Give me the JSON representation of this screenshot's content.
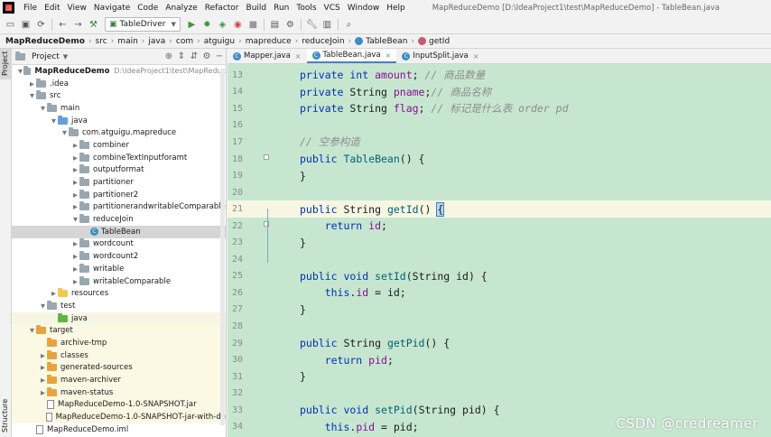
{
  "menubar": {
    "items": [
      "File",
      "Edit",
      "View",
      "Navigate",
      "Code",
      "Analyze",
      "Refactor",
      "Build",
      "Run",
      "Tools",
      "VCS",
      "Window",
      "Help"
    ],
    "title": "MapReduceDemo [D:\\IdeaProject1\\test\\MapReduceDemo] - TableBean.java"
  },
  "toolbar": {
    "run_config": "TableDriver"
  },
  "breadcrumb": [
    "MapReduceDemo",
    "src",
    "main",
    "java",
    "com",
    "atguigu",
    "mapreduce",
    "reduceJoin",
    "TableBean",
    "getId"
  ],
  "side_tabs": {
    "project": "Project",
    "structure": "Structure"
  },
  "project_panel": {
    "title": "Project",
    "root_path": "D:\\IdeaProject1\\test\\MapReduc",
    "tree": [
      {
        "label": "MapReduceDemo",
        "level": 0,
        "arrow": "open",
        "icon": "grey",
        "bold": true
      },
      {
        "label": ".idea",
        "level": 1,
        "arrow": "closed",
        "icon": "grey"
      },
      {
        "label": "src",
        "level": 1,
        "arrow": "open",
        "icon": "grey"
      },
      {
        "label": "main",
        "level": 2,
        "arrow": "open",
        "icon": "grey"
      },
      {
        "label": "java",
        "level": 3,
        "arrow": "open",
        "icon": "blue"
      },
      {
        "label": "com.atguigu.mapreduce",
        "level": 4,
        "arrow": "open",
        "icon": "grey"
      },
      {
        "label": "combiner",
        "level": 5,
        "arrow": "closed",
        "icon": "grey"
      },
      {
        "label": "combineTextInputforamt",
        "level": 5,
        "arrow": "closed",
        "icon": "grey"
      },
      {
        "label": "outputformat",
        "level": 5,
        "arrow": "closed",
        "icon": "grey"
      },
      {
        "label": "partitioner",
        "level": 5,
        "arrow": "closed",
        "icon": "grey"
      },
      {
        "label": "partitioner2",
        "level": 5,
        "arrow": "closed",
        "icon": "grey"
      },
      {
        "label": "partitionerandwritableComparable",
        "level": 5,
        "arrow": "closed",
        "icon": "grey"
      },
      {
        "label": "reduceJoin",
        "level": 5,
        "arrow": "open",
        "icon": "grey"
      },
      {
        "label": "TableBean",
        "level": 6,
        "arrow": "none",
        "icon": "class",
        "selected": true
      },
      {
        "label": "wordcount",
        "level": 5,
        "arrow": "closed",
        "icon": "grey"
      },
      {
        "label": "wordcount2",
        "level": 5,
        "arrow": "closed",
        "icon": "grey"
      },
      {
        "label": "writable",
        "level": 5,
        "arrow": "closed",
        "icon": "grey"
      },
      {
        "label": "writableComparable",
        "level": 5,
        "arrow": "closed",
        "icon": "grey"
      },
      {
        "label": "resources",
        "level": 3,
        "arrow": "closed",
        "icon": "yellow"
      },
      {
        "label": "test",
        "level": 2,
        "arrow": "open",
        "icon": "grey"
      },
      {
        "label": "java",
        "level": 3,
        "arrow": "none",
        "icon": "green",
        "row": "test-java"
      },
      {
        "label": "target",
        "level": 1,
        "arrow": "open",
        "icon": "orange",
        "row": "target"
      },
      {
        "label": "archive-tmp",
        "level": 2,
        "arrow": "none",
        "icon": "orange",
        "row": "target"
      },
      {
        "label": "classes",
        "level": 2,
        "arrow": "closed",
        "icon": "orange",
        "row": "target"
      },
      {
        "label": "generated-sources",
        "level": 2,
        "arrow": "closed",
        "icon": "orange",
        "row": "target"
      },
      {
        "label": "maven-archiver",
        "level": 2,
        "arrow": "closed",
        "icon": "orange",
        "row": "target"
      },
      {
        "label": "maven-status",
        "level": 2,
        "arrow": "closed",
        "icon": "orange",
        "row": "target"
      },
      {
        "label": "MapReduceDemo-1.0-SNAPSHOT.jar",
        "level": 2,
        "arrow": "none",
        "icon": "file",
        "row": "target"
      },
      {
        "label": "MapReduceDemo-1.0-SNAPSHOT-jar-with-de",
        "level": 2,
        "arrow": "none",
        "icon": "file",
        "row": "target"
      },
      {
        "label": "MapReduceDemo.iml",
        "level": 1,
        "arrow": "none",
        "icon": "file"
      }
    ]
  },
  "editor": {
    "tabs": [
      {
        "label": "Mapper.java",
        "active": false
      },
      {
        "label": "TableBean.java",
        "active": true
      },
      {
        "label": "InputSplit.java",
        "active": false
      }
    ],
    "lines": [
      {
        "n": "13",
        "tokens": [
          [
            "kw",
            "private int "
          ],
          [
            "fld",
            "amount"
          ],
          [
            "ty",
            "; "
          ],
          [
            "cm",
            "// 商品数量"
          ]
        ]
      },
      {
        "n": "14",
        "tokens": [
          [
            "kw",
            "private "
          ],
          [
            "ty",
            "String "
          ],
          [
            "fld",
            "pname"
          ],
          [
            "ty",
            ";"
          ],
          [
            "cm",
            "// 商品名称"
          ]
        ]
      },
      {
        "n": "15",
        "tokens": [
          [
            "kw",
            "private "
          ],
          [
            "ty",
            "String "
          ],
          [
            "fld",
            "flag"
          ],
          [
            "ty",
            "; "
          ],
          [
            "cm",
            "// 标记是什么表 order pd"
          ]
        ]
      },
      {
        "n": "16",
        "tokens": []
      },
      {
        "n": "17",
        "tokens": [
          [
            "cm",
            "// 空参构造"
          ]
        ]
      },
      {
        "n": "18",
        "tokens": [
          [
            "kw",
            "public "
          ],
          [
            "fn",
            "TableBean"
          ],
          [
            "ty",
            "() {"
          ]
        ]
      },
      {
        "n": "19",
        "tokens": [
          [
            "ty",
            "}"
          ]
        ]
      },
      {
        "n": "20",
        "tokens": []
      },
      {
        "n": "21",
        "tokens": [
          [
            "kw",
            "public "
          ],
          [
            "ty",
            "String "
          ],
          [
            "fn",
            "getId"
          ],
          [
            "ty",
            "() "
          ],
          [
            "brace",
            "{"
          ]
        ],
        "current": true
      },
      {
        "n": "22",
        "tokens": [
          [
            "kw",
            "    return "
          ],
          [
            "fld",
            "id"
          ],
          [
            "ty",
            ";"
          ]
        ]
      },
      {
        "n": "23",
        "tokens": [
          [
            "brace",
            "}"
          ]
        ]
      },
      {
        "n": "24",
        "tokens": []
      },
      {
        "n": "25",
        "tokens": [
          [
            "kw",
            "public void "
          ],
          [
            "fn",
            "setId"
          ],
          [
            "ty",
            "(String id) {"
          ]
        ]
      },
      {
        "n": "26",
        "tokens": [
          [
            "kw",
            "    this"
          ],
          [
            "ty",
            "."
          ],
          [
            "fld",
            "id"
          ],
          [
            "ty",
            " = id;"
          ]
        ]
      },
      {
        "n": "27",
        "tokens": [
          [
            "ty",
            "}"
          ]
        ]
      },
      {
        "n": "28",
        "tokens": []
      },
      {
        "n": "29",
        "tokens": [
          [
            "kw",
            "public "
          ],
          [
            "ty",
            "String "
          ],
          [
            "fn",
            "getPid"
          ],
          [
            "ty",
            "() {"
          ]
        ]
      },
      {
        "n": "30",
        "tokens": [
          [
            "kw",
            "    return "
          ],
          [
            "fld",
            "pid"
          ],
          [
            "ty",
            ";"
          ]
        ]
      },
      {
        "n": "31",
        "tokens": [
          [
            "ty",
            "}"
          ]
        ]
      },
      {
        "n": "32",
        "tokens": []
      },
      {
        "n": "33",
        "tokens": [
          [
            "kw",
            "public void "
          ],
          [
            "fn",
            "setPid"
          ],
          [
            "ty",
            "(String pid) {"
          ]
        ]
      },
      {
        "n": "34",
        "tokens": [
          [
            "kw",
            "    this"
          ],
          [
            "ty",
            "."
          ],
          [
            "fld",
            "pid"
          ],
          [
            "ty",
            " = pid;"
          ]
        ]
      }
    ]
  },
  "watermark": "CSDN @credreamer",
  "colors": {
    "editor_bg": "#c7e6d0",
    "keyword": "#0033b3",
    "field": "#871094",
    "comment": "#8c8c8c",
    "method": "#00627a",
    "selection": "#d5d5d5"
  }
}
